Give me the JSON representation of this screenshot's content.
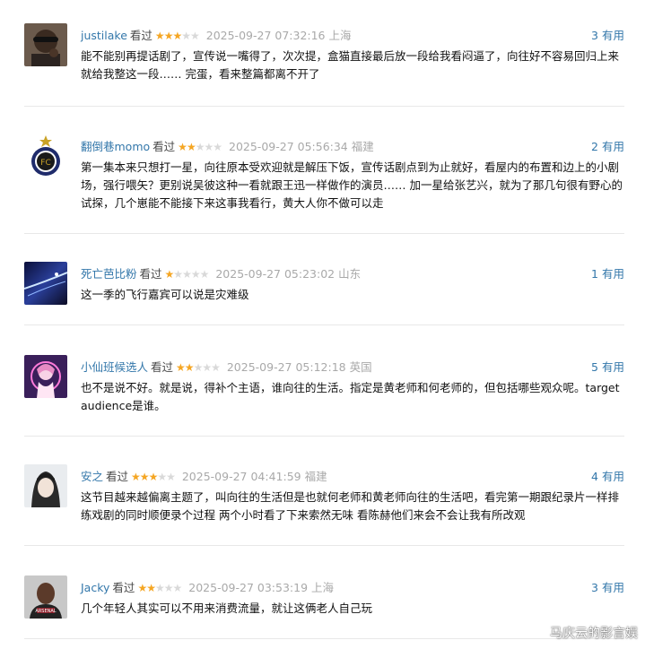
{
  "comments": [
    {
      "user": "justilake",
      "watched": "看过",
      "rating": 3,
      "time": "2025-09-27 07:32:16",
      "location": "上海",
      "votes_count": "3",
      "votes_label": "有用",
      "text": "能不能别再提话剧了，宣传说一嘴得了，次次提，盒猫直接最后放一段给我看闷逼了，向往好不容易回归上来就给我整这一段…… 完蛋，看来整篇都离不开了"
    },
    {
      "user": "翻倒巷momo",
      "watched": "看过",
      "rating": 2,
      "time": "2025-09-27 05:56:34",
      "location": "福建",
      "votes_count": "2",
      "votes_label": "有用",
      "text": "第一集本来只想打一星，向往原本受欢迎就是解压下饭，宣传话剧点到为止就好，看屋内的布置和边上的小剧场，强行喂矢？更别说吴彼这种一看就跟王迅一样做作的演员…… 加一星给张艺兴，就为了那几句很有野心的试探，几个崽能不能接下来这事我看行，黄大人你不做可以走"
    },
    {
      "user": "死亡芭比粉",
      "watched": "看过",
      "rating": 1,
      "time": "2025-09-27 05:23:02",
      "location": "山东",
      "votes_count": "1",
      "votes_label": "有用",
      "text": "这一季的飞行嘉宾可以说是灾难级"
    },
    {
      "user": "小仙班候选人",
      "watched": "看过",
      "rating": 2,
      "time": "2025-09-27 05:12:18",
      "location": "英国",
      "votes_count": "5",
      "votes_label": "有用",
      "text": "也不是说不好。就是说，得补个主语，谁向往的生活。指定是黄老师和何老师的，但包括哪些观众呢。target audience是谁。"
    },
    {
      "user": "安之",
      "watched": "看过",
      "rating": 3,
      "time": "2025-09-27 04:41:59",
      "location": "福建",
      "votes_count": "4",
      "votes_label": "有用",
      "text": "这节目越来越偏离主题了，叫向往的生活但是也就何老师和黄老师向往的生活吧，看完第一期跟纪录片一样排练戏剧的同时顺便录个过程 两个小时看了下来索然无味 看陈赫他们来会不会让我有所改观"
    },
    {
      "user": "Jacky",
      "watched": "看过",
      "rating": 2,
      "time": "2025-09-27 03:53:19",
      "location": "上海",
      "votes_count": "3",
      "votes_label": "有用",
      "text": "几个年轻人其实可以不用来消费流量，就让这俩老人自己玩"
    }
  ],
  "colors": {
    "link": "#3377aa",
    "star": "#f5a623",
    "star_off": "#d9d9d9",
    "meta": "#a9a9a9",
    "divider": "#e8e8e8"
  },
  "watermark": "马庆云的影言娱"
}
